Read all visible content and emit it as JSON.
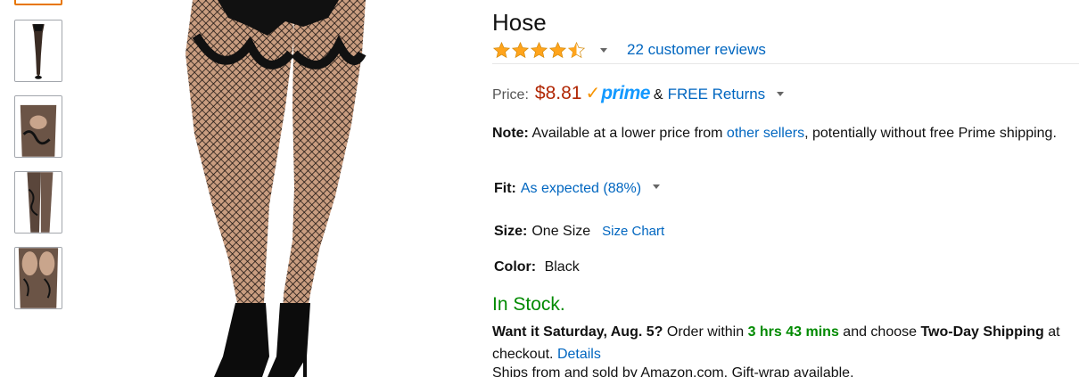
{
  "product": {
    "title_line": "Hose"
  },
  "rating": {
    "stars": 4.5,
    "reviews_label": "22 customer reviews"
  },
  "price": {
    "label": "Price:",
    "amount": "$8.81",
    "prime_check": "✓",
    "prime_word": "prime",
    "amp": "&",
    "free_returns": "FREE Returns"
  },
  "note": {
    "label": "Note:",
    "text_before": " Available at a lower price from ",
    "link": "other sellers",
    "text_after": ", potentially without free Prime shipping."
  },
  "fit": {
    "label": "Fit:",
    "value": "As expected (88%)"
  },
  "size": {
    "label": "Size:",
    "value": "One Size",
    "chart_link": "Size Chart"
  },
  "color": {
    "label": "Color:",
    "value": "Black"
  },
  "availability": "In Stock.",
  "delivery": {
    "question": "Want it Saturday, Aug. 5?",
    "order_within": " Order within ",
    "time": "3 hrs 43 mins",
    "and_choose": " and choose ",
    "shipping": "Two-Day Shipping",
    "at_checkout": " at checkout. ",
    "details": "Details"
  },
  "ships_from": "Ships from and sold by Amazon.com. Gift-wrap available.",
  "colors": {
    "price": "#b12704",
    "link": "#0066c0",
    "in_stock": "#008a00",
    "prime": "#1399ff",
    "star": "#ffa41c",
    "thumb_selected_border": "#e77600"
  }
}
